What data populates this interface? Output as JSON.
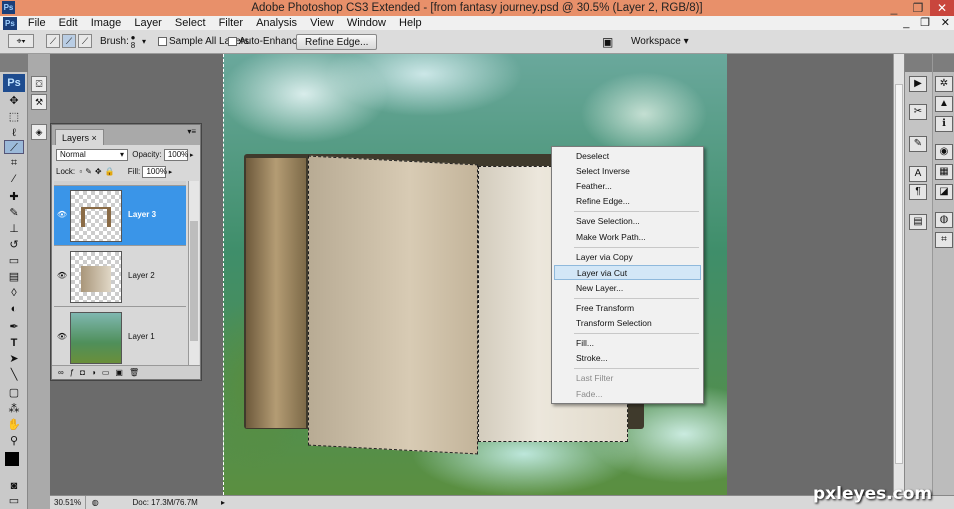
{
  "window": {
    "title": "Adobe Photoshop CS3 Extended - [from fantasy journey.psd @ 30.5% (Layer 2, RGB/8)]",
    "app_badge": "Ps",
    "minimize": "_",
    "restore": "❐",
    "close": "✕"
  },
  "menubar": {
    "doc_icon": "Ps",
    "items": [
      "File",
      "Edit",
      "Image",
      "Layer",
      "Select",
      "Filter",
      "Analysis",
      "View",
      "Window",
      "Help"
    ],
    "minimize": "_",
    "restore": "❐",
    "close": "✕"
  },
  "options_bar": {
    "brush_label": "Brush:",
    "brush_size": "8",
    "sample_all_layers": "Sample All Layers",
    "auto_enhance": "Auto-Enhance",
    "refine_edge": "Refine Edge...",
    "workspace": "Workspace ▾"
  },
  "toolbox": {
    "logo": "Ps"
  },
  "layers_panel": {
    "tab": "Layers",
    "tab_close": "×",
    "blend_mode": "Normal",
    "opacity_label": "Opacity:",
    "opacity_value": "100%",
    "lock_label": "Lock:",
    "fill_label": "Fill:",
    "fill_value": "100%",
    "layers": [
      {
        "name": "Layer 3",
        "active": true
      },
      {
        "name": "Layer 2",
        "active": false
      },
      {
        "name": "Layer 1",
        "active": false
      }
    ]
  },
  "context_menu": {
    "items": [
      {
        "label": "Deselect",
        "state": "normal"
      },
      {
        "label": "Select Inverse",
        "state": "normal"
      },
      {
        "label": "Feather...",
        "state": "normal"
      },
      {
        "label": "Refine Edge...",
        "state": "normal"
      },
      {
        "label": "Save Selection...",
        "state": "normal"
      },
      {
        "label": "Make Work Path...",
        "state": "normal"
      },
      {
        "label": "Layer via Copy",
        "state": "normal"
      },
      {
        "label": "Layer via Cut",
        "state": "highlighted"
      },
      {
        "label": "New Layer...",
        "state": "normal"
      },
      {
        "label": "Free Transform",
        "state": "normal"
      },
      {
        "label": "Transform Selection",
        "state": "normal"
      },
      {
        "label": "Fill...",
        "state": "normal"
      },
      {
        "label": "Stroke...",
        "state": "normal"
      },
      {
        "label": "Last Filter",
        "state": "disabled"
      },
      {
        "label": "Fade...",
        "state": "disabled"
      }
    ]
  },
  "status_bar": {
    "zoom": "30.51%",
    "doc": "Doc: 17.3M/76.7M"
  },
  "watermark": "pxleyes.com",
  "colors": {
    "title_bar": "#e8906a",
    "selection": "#3a95e8",
    "menu_highlight": "#d3e7f7"
  }
}
